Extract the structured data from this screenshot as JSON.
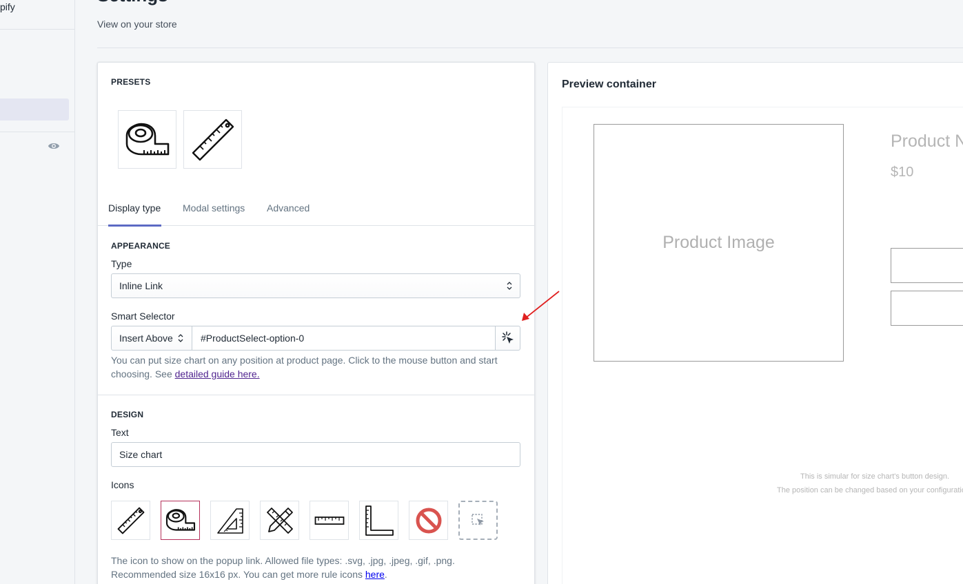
{
  "nav": {
    "brand": "pify"
  },
  "header": {
    "title": "Settings",
    "view_store": "View on your store"
  },
  "presets": {
    "heading": "PRESETS",
    "items": [
      "tape-measure-icon",
      "ruler-icon"
    ]
  },
  "tabs": [
    {
      "label": "Display type",
      "active": true
    },
    {
      "label": "Modal settings",
      "active": false
    },
    {
      "label": "Advanced",
      "active": false
    }
  ],
  "appearance": {
    "heading": "APPEARANCE",
    "type_label": "Type",
    "type_value": "Inline Link",
    "smart_selector_label": "Smart Selector",
    "insert_position": "Insert Above",
    "selector_value": "#ProductSelect-option-0",
    "help_text": "You can put size chart on any position at product page. Click to the mouse button and start choosing. See ",
    "help_link": "detailed guide here.",
    "help_suffix": ""
  },
  "design": {
    "heading": "DESIGN",
    "text_label": "Text",
    "text_value": "Size chart",
    "icons_label": "Icons",
    "icons": [
      "ruler-icon",
      "tape-measure-icon",
      "triangle-ruler-icon",
      "pencil-ruler-icon",
      "straight-ruler-icon",
      "l-square-ruler-icon",
      "no-icon",
      "upload-icon"
    ],
    "selected_icon": 1,
    "help_text": "The icon to show on the popup link. Allowed file types: .svg, .jpg, .jpeg, .gif, .png. Recommended size 16x16 px. You can get more rule icons ",
    "help_link": "here",
    "help_suffix": "."
  },
  "preview": {
    "title": "Preview container",
    "product_image": "Product Image",
    "product_name": "Product N",
    "price": "$10",
    "note_1": "This is simular for size chart's button design.",
    "note_2": "The position can be changed based on your configuratio"
  },
  "colors": {
    "accent": "#5c6ac4",
    "annotation_arrow": "#e02020",
    "selected_border": "#b5305a",
    "no_icon": "#d9534f"
  }
}
